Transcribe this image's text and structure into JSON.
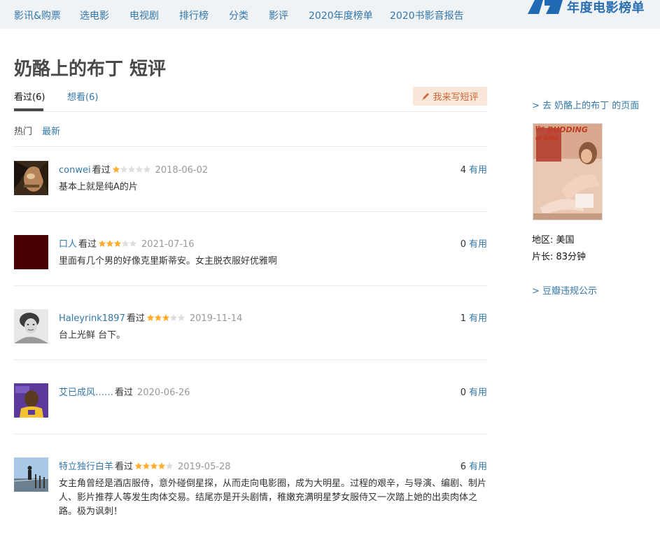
{
  "nav": {
    "items": [
      "影讯&购票",
      "选电影",
      "电视剧",
      "排行榜",
      "分类",
      "影评",
      "2020年度榜单",
      "2020书影音报告"
    ],
    "brand_text": "年度电影榜单"
  },
  "page": {
    "title": "奶酪上的布丁 短评"
  },
  "tabs": {
    "watched": "看过(6)",
    "wish": "想看(6)",
    "write_button": "我来写短评"
  },
  "sort": {
    "hot": "热门",
    "latest": "最新"
  },
  "comments": [
    {
      "user": "conwei",
      "status": "看过",
      "rating": 1,
      "time": "2018-06-02",
      "useful_count": "4",
      "useful_label": "有用",
      "text": "基本上就是纯A的片"
    },
    {
      "user": "口人",
      "status": "看过",
      "rating": 3,
      "time": "2021-07-16",
      "useful_count": "0",
      "useful_label": "有用",
      "text": "里面有几个男的好像克里斯蒂安。女主脱衣服好优雅啊"
    },
    {
      "user": "Haleyrink1897",
      "status": "看过",
      "rating": 3,
      "time": "2019-11-14",
      "useful_count": "1",
      "useful_label": "有用",
      "text": "台上光鲜 台下。"
    },
    {
      "user": "艾已成风……",
      "status": "看过",
      "rating": 0,
      "time": "2020-06-26",
      "useful_count": "0",
      "useful_label": "有用",
      "text": ""
    },
    {
      "user": "特立独行白羊",
      "status": "看过",
      "rating": 4,
      "time": "2019-05-28",
      "useful_count": "6",
      "useful_label": "有用",
      "text": "女主角曾经是酒店服侍，意外碰倒星探，从而走向电影圈，成为大明星。过程的艰辛，与导演、编剧、制片人、影片推荐人等发生肉体交易。结尾亦是开头剧情，稚嫩充满明星梦女服侍又一次踏上她的出卖肉体之路。极为讽刺！"
    }
  ],
  "sidebar": {
    "goto_link": "> 去 奶酪上的布丁 的页面",
    "region": "地区: 美国",
    "duration": "片长: 83分钟",
    "report_link": "> 豆瓣违规公示",
    "poster_title_line1": "the",
    "poster_title_line2": "BUDDING",
    "poster_title_line3": "of BRIE"
  },
  "colors": {
    "link": "#3377aa",
    "star": "#ffac2d",
    "star_empty": "#dddddd",
    "write_bg": "#fae7da",
    "write_fg": "#cc6633"
  }
}
